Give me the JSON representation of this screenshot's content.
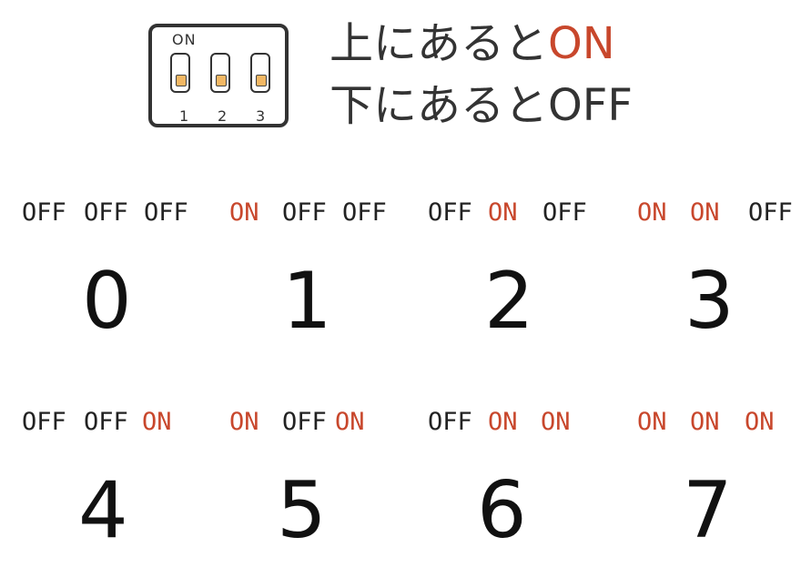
{
  "legend": {
    "dip": {
      "on_label": "ON",
      "switch_numbers": [
        "1",
        "2",
        "3"
      ]
    },
    "line_on": {
      "prefix": "上にあると",
      "state": "ON"
    },
    "line_off": {
      "prefix": "下にあると",
      "state": "OFF"
    }
  },
  "colors": {
    "on": "#c8472c",
    "off": "#222222",
    "knob": "#f2b763"
  },
  "combinations": [
    {
      "states": [
        "OFF",
        "OFF",
        "OFF"
      ],
      "value": "0"
    },
    {
      "states": [
        "ON",
        "OFF",
        "OFF"
      ],
      "value": "1"
    },
    {
      "states": [
        "OFF",
        "ON",
        "OFF"
      ],
      "value": "2"
    },
    {
      "states": [
        "ON",
        "ON",
        "OFF"
      ],
      "value": "3"
    },
    {
      "states": [
        "OFF",
        "OFF",
        "ON"
      ],
      "value": "4"
    },
    {
      "states": [
        "ON",
        "OFF",
        "ON"
      ],
      "value": "5"
    },
    {
      "states": [
        "OFF",
        "ON",
        "ON"
      ],
      "value": "6"
    },
    {
      "states": [
        "ON",
        "ON",
        "ON"
      ],
      "value": "7"
    }
  ]
}
